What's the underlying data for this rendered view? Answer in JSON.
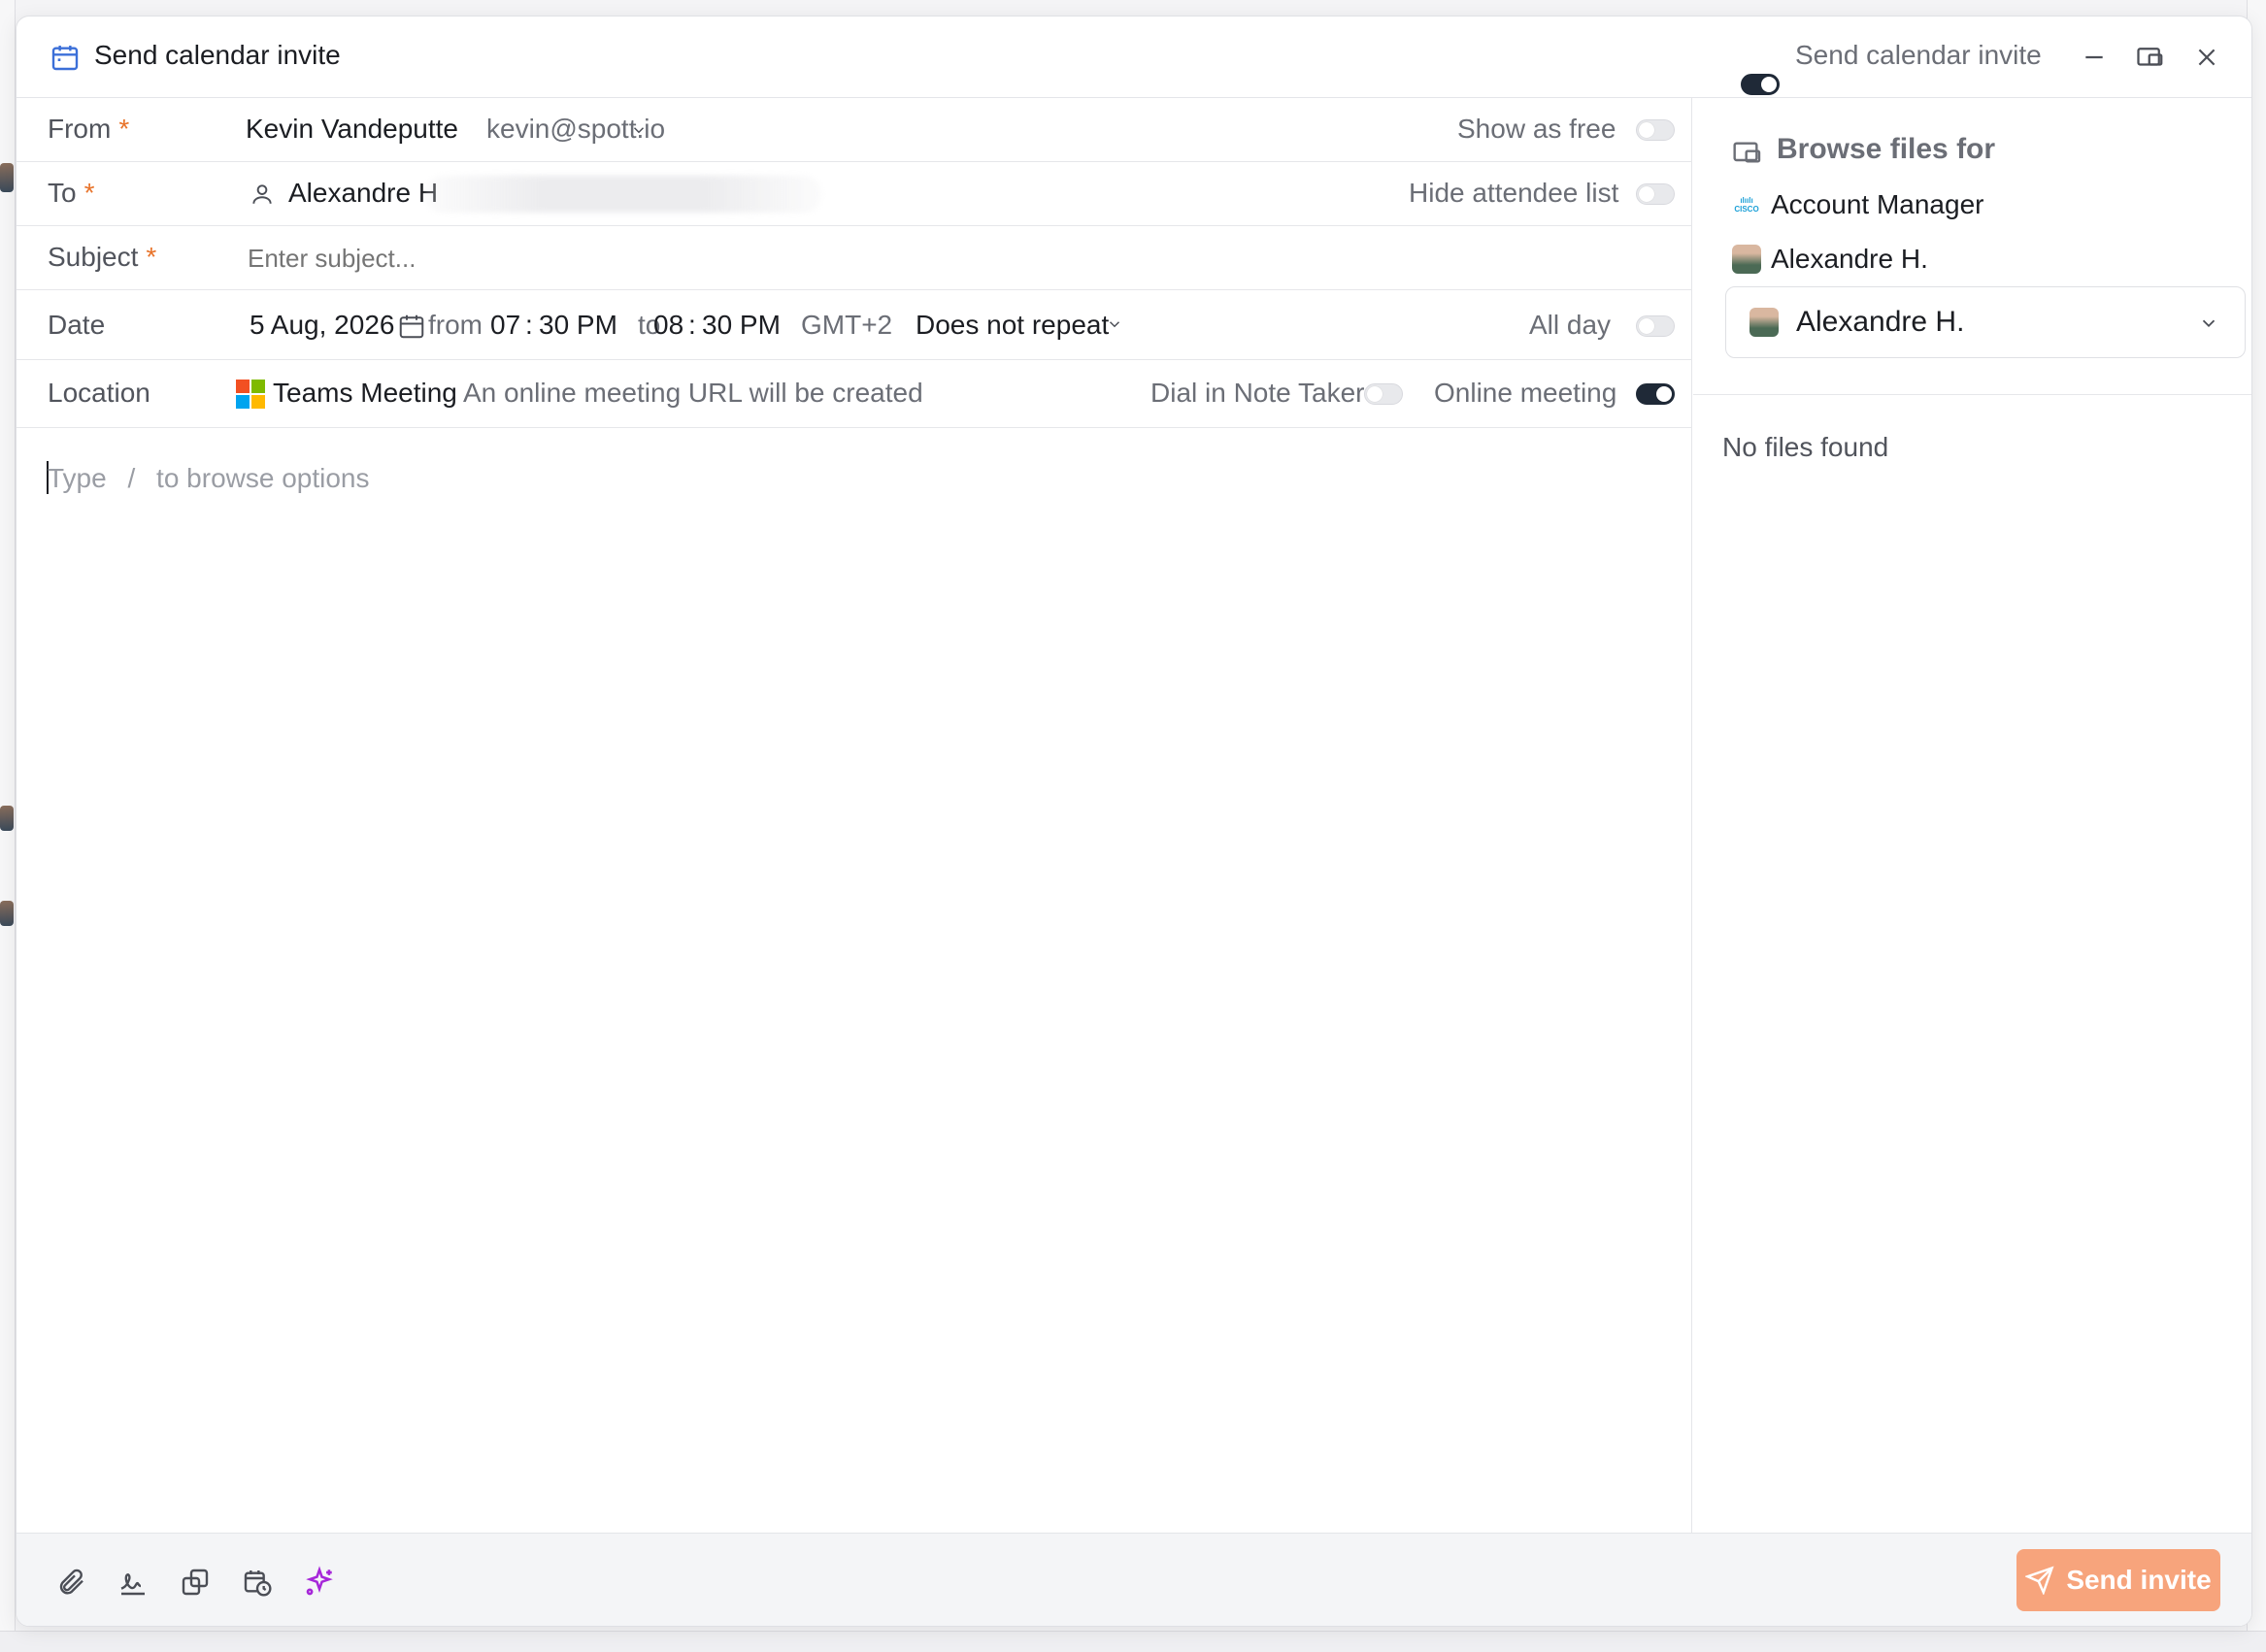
{
  "window": {
    "title": "Send calendar invite",
    "toggle_label": "Send calendar invite",
    "toggle_on": true
  },
  "form": {
    "from": {
      "label": "From",
      "required": "*",
      "name": "Kevin Vandeputte",
      "email": "kevin@spott.io",
      "toggle_label": "Show as free",
      "toggle_on": false
    },
    "to": {
      "label": "To",
      "required": "*",
      "recipient": "Alexandre H",
      "toggle_label": "Hide attendee list",
      "toggle_on": false
    },
    "subject": {
      "label": "Subject",
      "required": "*",
      "placeholder": "Enter subject..."
    },
    "date": {
      "label": "Date",
      "date": "5 Aug, 2026",
      "from_label": "from",
      "start_hour": "07",
      "start_min": "30 PM",
      "to_label": "to",
      "end_hour": "08",
      "end_min": "30 PM",
      "timezone": "GMT+2",
      "repeat": "Does not repeat",
      "toggle_label": "All day",
      "toggle_on": false
    },
    "location": {
      "label": "Location",
      "provider": "Teams Meeting",
      "note": "An online meeting URL will be created",
      "dial_label": "Dial in Note Taker",
      "dial_on": false,
      "online_label": "Online meeting",
      "online_on": true
    },
    "editor": {
      "placeholder_a": "Type",
      "placeholder_sep": "/",
      "placeholder_b": "to browse options"
    }
  },
  "side": {
    "heading": "Browse files for",
    "items": [
      {
        "icon": "cisco-logo",
        "label": "Account Manager"
      },
      {
        "icon": "avatar",
        "label": "Alexandre H."
      }
    ],
    "select_value": "Alexandre H.",
    "empty": "No files found"
  },
  "footer": {
    "icons": [
      "paperclip-icon",
      "signature-icon",
      "copy-icon",
      "calendar-clock-icon",
      "sparkles-icon"
    ],
    "send_label": "Send invite",
    "send_color": "#f7a47c",
    "sparkle_color": "#a626d9"
  },
  "colors": {
    "required": "#e8732a",
    "toggle_on": "#1f2937"
  }
}
